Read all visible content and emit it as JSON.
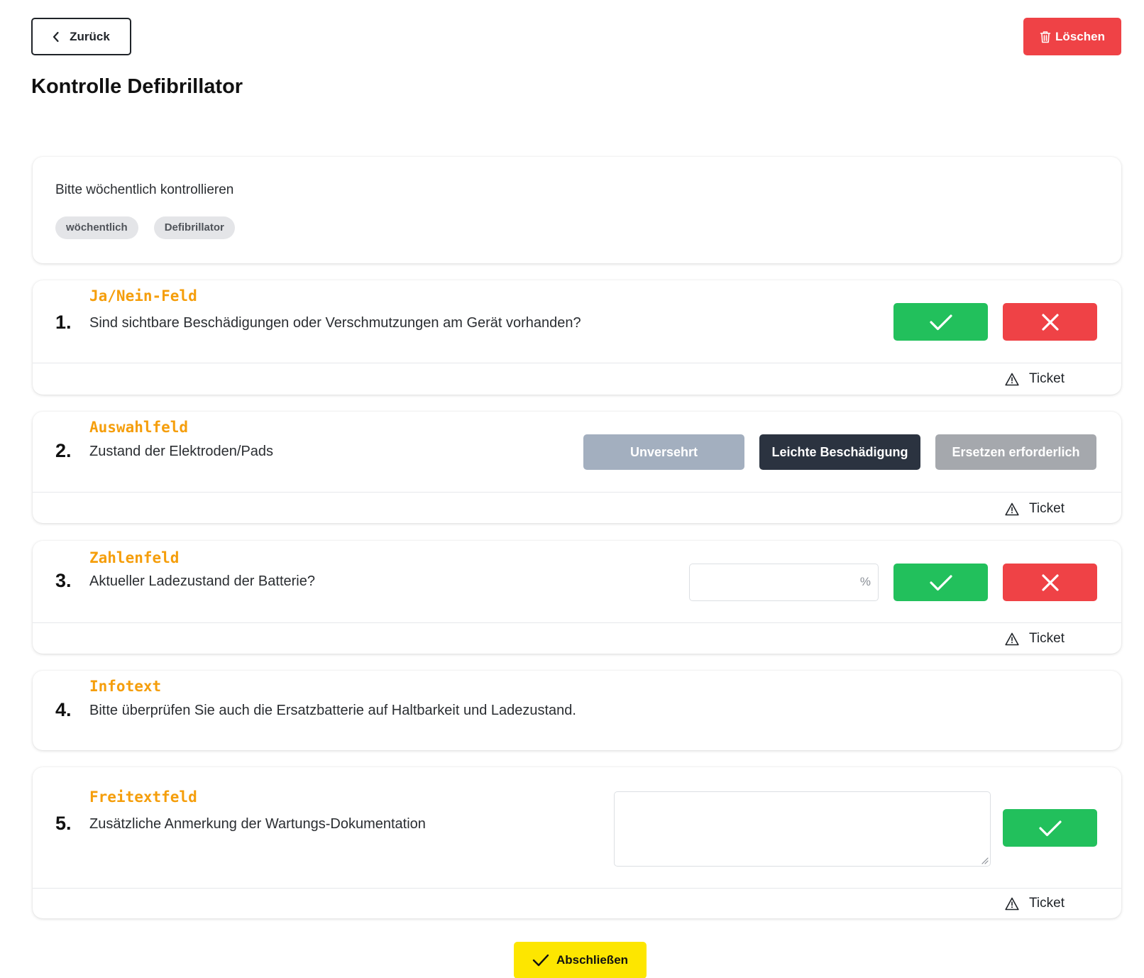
{
  "header": {
    "back_label": "Zurück",
    "delete_label": "Löschen",
    "title": "Kontrolle Defibrillator"
  },
  "intro": {
    "description": "Bitte wöchentlich kontrollieren",
    "tags": [
      "wöchentlich",
      "Defibrillator"
    ]
  },
  "questions": [
    {
      "number": "1.",
      "type": "Ja/Nein-Feld",
      "text": "Sind sichtbare Beschädigungen oder Verschmutzungen am Gerät vorhanden?",
      "ticket_label": "Ticket"
    },
    {
      "number": "2.",
      "type": "Auswahlfeld",
      "text": "Zustand der Elektroden/Pads",
      "ticket_label": "Ticket",
      "options": [
        "Unversehrt",
        "Leichte Beschädigung",
        "Ersetzen erforderlich"
      ],
      "selected": "Leichte Beschädigung"
    },
    {
      "number": "3.",
      "type": "Zahlenfeld",
      "text": "Aktueller Ladezustand der Batterie?",
      "ticket_label": "Ticket",
      "unit": "%",
      "value": ""
    },
    {
      "number": "4.",
      "type": "Infotext",
      "text": "Bitte überprüfen Sie auch die Ersatzbatterie auf Haltbarkeit und Ladezustand."
    },
    {
      "number": "5.",
      "type": "Freitextfeld",
      "text": "Zusätzliche Anmerkung der Wartungs-Dokumentation",
      "ticket_label": "Ticket",
      "value": ""
    }
  ],
  "footer": {
    "finish_label": "Abschließen"
  },
  "colors": {
    "yes": "#22c05c",
    "no": "#ef4246",
    "delete": "#ef4246",
    "finish": "#fde600",
    "type_label": "#f59e0b",
    "option_unversehrt": "#a3afbf",
    "option_selected": "#2b3340",
    "option_ersetzen": "#a5a8ad"
  }
}
